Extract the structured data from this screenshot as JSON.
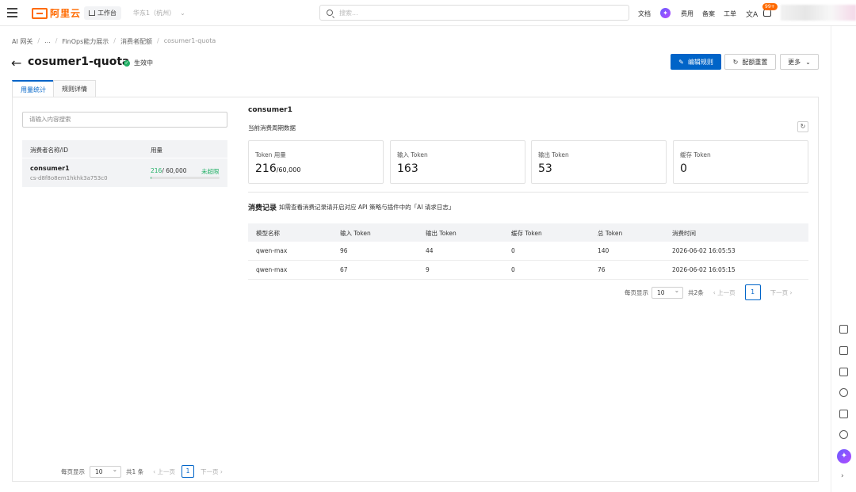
{
  "topbar": {
    "logo_text": "阿里云",
    "workbench": "工作台",
    "region": "华东1（杭州）",
    "search_placeholder": "搜索...",
    "links": [
      "文档",
      "费用",
      "备案",
      "工单"
    ],
    "notif_badge": "99+"
  },
  "breadcrumb": [
    "AI 网关",
    "...",
    "FinOps能力展示",
    "消费者配额",
    "cosumer1-quota"
  ],
  "page": {
    "title": "cosumer1-quota",
    "status": "生效中"
  },
  "actions": {
    "edit": "编辑规则",
    "reset": "配额重置",
    "more": "更多"
  },
  "tabs": [
    "用量统计",
    "规则详情"
  ],
  "left": {
    "search_placeholder": "请输入内容搜索",
    "col_name": "消费者名称/ID",
    "col_usage": "用量",
    "consumer": {
      "name": "consumer1",
      "id": "cs-d8f8o8em1hkhk3a753c0",
      "used": "216",
      "quota": "/ 60,000",
      "usage_fraction": 0.0036,
      "state": "未超限"
    },
    "pager": {
      "per_page_label": "每页显示",
      "per_page": "10",
      "total": "共1 条",
      "prev": "上一页",
      "page": "1",
      "next": "下一页"
    }
  },
  "right": {
    "consumer_title": "consumer1",
    "period_label": "当前消费周期数据",
    "cards": [
      {
        "label": "Token 用量",
        "value": "216",
        "suffix": "/60,000"
      },
      {
        "label": "输入 Token",
        "value": "163",
        "suffix": ""
      },
      {
        "label": "输出 Token",
        "value": "53",
        "suffix": ""
      },
      {
        "label": "缓存 Token",
        "value": "0",
        "suffix": ""
      }
    ],
    "records_title": "消费记录",
    "records_note": "如需查看消费记录请开启对应 API 策略与插件中的「AI 请求日志」",
    "columns": [
      "模型名称",
      "输入 Token",
      "输出 Token",
      "缓存 Token",
      "总 Token",
      "消费时间"
    ],
    "rows": [
      [
        "qwen-max",
        "96",
        "44",
        "0",
        "140",
        "2026-06-02 16:05:53"
      ],
      [
        "qwen-max",
        "67",
        "9",
        "0",
        "76",
        "2026-06-02 16:05:15"
      ]
    ],
    "pager": {
      "per_page_label": "每页显示",
      "per_page": "10",
      "total": "共2条",
      "prev": "上一页",
      "page": "1",
      "next": "下一页"
    }
  },
  "colors": {
    "primary": "#0064c8",
    "brand": "#ff6a00",
    "success": "#23b066"
  }
}
